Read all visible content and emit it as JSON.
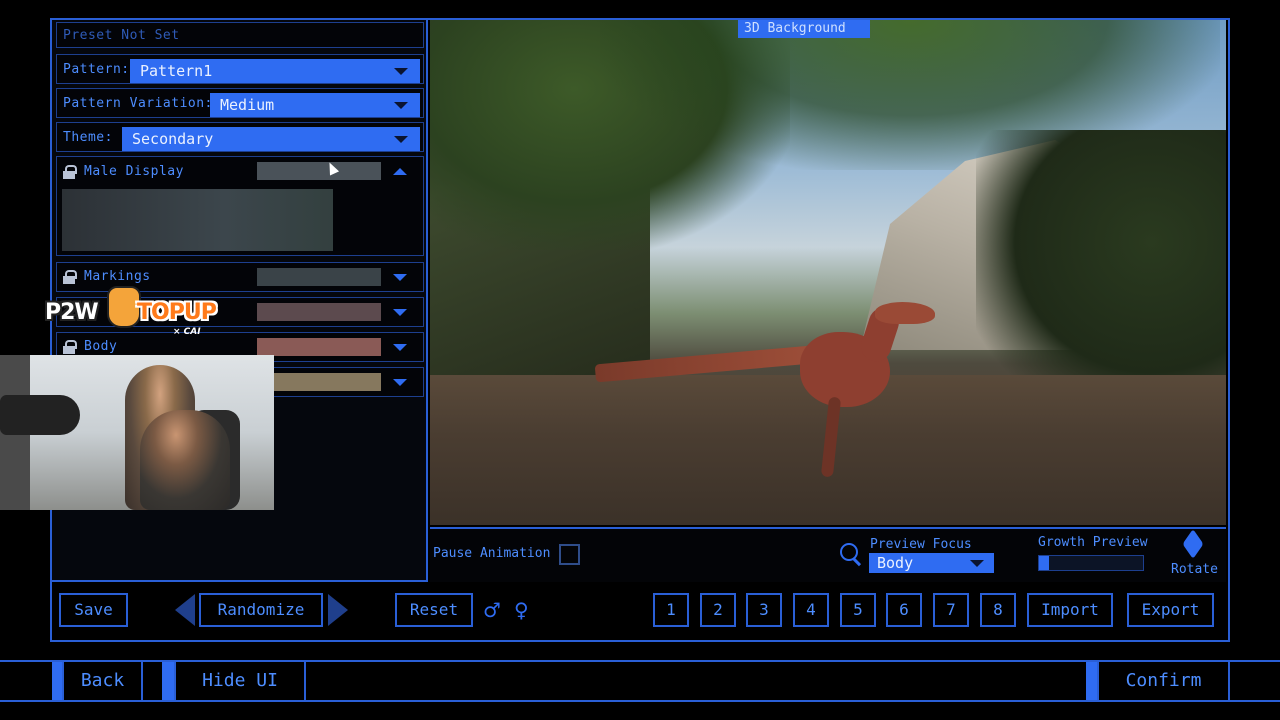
{
  "left_panel": {
    "preset_label": "Preset Not Set",
    "pattern": {
      "label": "Pattern:",
      "value": "Pattern1"
    },
    "pattern_variation": {
      "label": "Pattern Variation:",
      "value": "Medium"
    },
    "theme": {
      "label": "Theme:",
      "value": "Secondary"
    },
    "color_rows": [
      {
        "label": "Male Display",
        "swatch_color": "#4a5259",
        "expanded": true
      },
      {
        "label": "Markings",
        "swatch_color": "#3a4348",
        "expanded": false
      },
      {
        "label": "",
        "swatch_color": "#5c4a4e",
        "expanded": false
      },
      {
        "label": "Body",
        "swatch_color": "#8a5a56",
        "expanded": false
      },
      {
        "label": "",
        "swatch_color": "#86785e",
        "expanded": false
      }
    ]
  },
  "viewport": {
    "background_label": "3D Background"
  },
  "controls": {
    "pause_animation_label": "Pause Animation",
    "preview_focus_label": "Preview Focus",
    "preview_focus_value": "Body",
    "growth_preview_label": "Growth Preview",
    "growth_preview_value": 0.1,
    "rotate_label": "Rotate"
  },
  "toolbar": {
    "save_label": "Save",
    "randomize_label": "Randomize",
    "reset_label": "Reset",
    "male_symbol": "♂",
    "female_symbol": "♀",
    "slots": [
      "1",
      "2",
      "3",
      "4",
      "5",
      "6",
      "7",
      "8"
    ],
    "import_label": "Import",
    "export_label": "Export"
  },
  "bottom_bar": {
    "back_label": "Back",
    "hide_ui_label": "Hide UI",
    "confirm_label": "Confirm"
  },
  "overlay": {
    "logo_left": "P2W",
    "logo_right": "TOPUP",
    "logo_sub": "× CAI"
  },
  "colors": {
    "accent": "#2f6cf2",
    "border": "#2a5fd6",
    "text": "#4d8dff"
  }
}
